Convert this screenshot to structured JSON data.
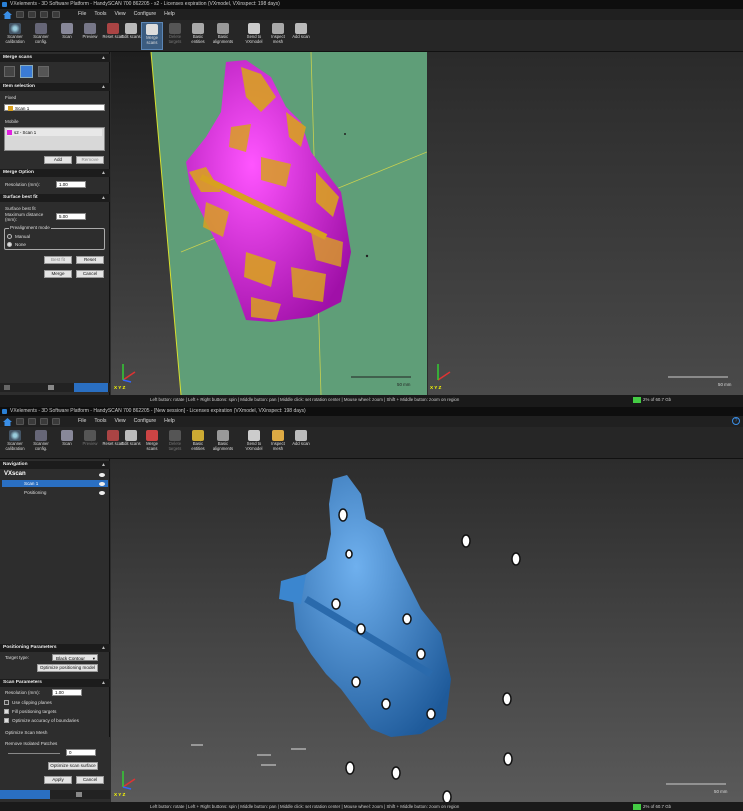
{
  "win1": {
    "title": "VXelements - 3D Software Platform - HandySCAN 700 862205 - s2 - Licenses expiration (VXmodel, VXinspect: 198 days)",
    "menu": [
      "File",
      "Tools",
      "View",
      "Configure",
      "Help"
    ],
    "toolbar": [
      "Scanner calibration",
      "Scanner config.",
      "Scan",
      "Preview",
      "Reset scan",
      "Edit scans",
      "Merge scans",
      "Delete targets",
      "Basic entities",
      "Basic alignments",
      "Send to VXmodel",
      "Inspect mesh",
      "Add scan"
    ],
    "merge_scans": "Merge scans",
    "item_selection": "Item selection",
    "fixed": "Fixed",
    "fixed_value": "Scan 1",
    "mobile": "Mobile",
    "mobile_item": "s2 - Scan 1",
    "add": "Add",
    "remove": "Remove",
    "merge_option": "Merge Option",
    "resolution_label": "Resolution (mm):",
    "resolution_value": "1.00",
    "surface_best_fit": "Surface best fit",
    "surface_best_fit_sub": "Surface best fit",
    "max_distance_label": "Maximum distance (mm):",
    "max_distance_value": "5.00",
    "prealign_mode": "Prealignment mode",
    "manual": "Manual",
    "none": "None",
    "best_fit": "Best fit",
    "reset": "Reset",
    "merge": "Merge",
    "cancel": "Cancel",
    "status": "Left button: rotate | Left + Right buttons: spin | Middle button: pan | Middle click: set rotation center | Mouse wheel: zoom | Shift + Middle button: zoom on region",
    "memory": "2% of 60.7 Gb",
    "scale_left": "50 mm",
    "scale_right": "50 mm"
  },
  "win2": {
    "title": "VXelements - 3D Software Platform - HandySCAN 700 862205 - [New session] - Licenses expiration (VXmodel, VXinspect: 198 days)",
    "menu": [
      "File",
      "Tools",
      "View",
      "Configure",
      "Help"
    ],
    "toolbar": [
      "Scanner calibration",
      "Scanner config.",
      "Scan",
      "Preview",
      "Reset scan",
      "Edit scans",
      "Merge scans",
      "Delete targets",
      "Basic entities",
      "Basic alignments",
      "Send to VXmodel",
      "Inspect mesh",
      "Add scan"
    ],
    "navigation": "Navigation",
    "vxscan": "VXscan",
    "scan1": "Scan 1",
    "positioning": "Positioning",
    "positioning_params": "Positioning Parameters",
    "target_type_label": "Target type:",
    "target_type_value": "Black Contour",
    "optimize_positioning": "Optimize positioning model",
    "scan_params": "Scan Parameters",
    "resolution_label": "Resolution (mm):",
    "resolution_value": "1.00",
    "use_clipping": "Use clipping planes",
    "fill_targets": "Fill positioning targets",
    "optimize_boundaries": "Optimize accuracy of boundaries",
    "optimize_mesh": "Optimize Scan Mesh",
    "decimate_mesh": "Decimate Scan Mesh",
    "auto_fill": "Auto. Fill Holes",
    "remove_patches": "Remove Isolated Patches",
    "spin_values": [
      "0",
      "0",
      "0",
      "0"
    ],
    "optimize_scan_surface": "Optimize scan surface",
    "apply": "Apply",
    "cancel": "Cancel",
    "status": "Left button: rotate | Left + Right buttons: spin | Middle button: pan | Middle click: set rotation center | Mouse wheel: zoom | Shift + Middle button: zoom on region",
    "memory": "2% of 60.7 Gb",
    "scale": "50 mm"
  },
  "colors": {
    "accent": "#3a7bd5",
    "scan_magenta": "#e020e0",
    "scan_orange": "#d8a020",
    "scan_blue": "#2e79c4",
    "green_viewport": "#5f9e78"
  }
}
